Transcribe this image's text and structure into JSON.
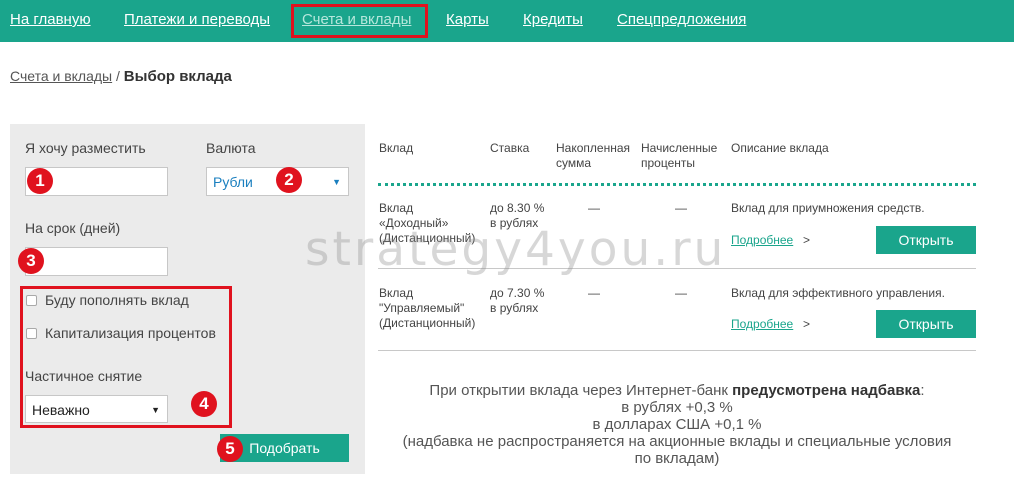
{
  "nav": {
    "items": [
      {
        "label": "На главную"
      },
      {
        "label": "Платежи и переводы"
      },
      {
        "label": "Счета и вклады"
      },
      {
        "label": "Карты"
      },
      {
        "label": "Кредиты"
      },
      {
        "label": "Спецпредложения"
      }
    ],
    "active_index": 2
  },
  "breadcrumb": {
    "parent": "Счета и вклады",
    "separator": "/",
    "current": "Выбор вклада"
  },
  "filters": {
    "amount_label": "Я хочу разместить",
    "amount_value": "",
    "currency_label": "Валюта",
    "currency_value": "Рубли",
    "term_label": "На срок (дней)",
    "term_value": "",
    "replenish_label": "Буду пополнять вклад",
    "replenish_checked": false,
    "capitalization_label": "Капитализация процентов",
    "capitalization_checked": false,
    "partial_label": "Частичное снятие",
    "partial_value": "Неважно",
    "submit_label": "Подобрать"
  },
  "table": {
    "headers": {
      "deposit": "Вклад",
      "rate": "Ставка",
      "accumulated": "Накопленная сумма",
      "accrued": "Начисленные проценты",
      "description": "Описание вклада"
    },
    "rows": [
      {
        "name_line1": "Вклад",
        "name_line2": "«Доходный»",
        "name_line3": "(Дистанционный)",
        "rate_line1": "до 8.30 %",
        "rate_line2": "в рублях",
        "accumulated": "—",
        "accrued": "—",
        "description": "Вклад для приумножения средств.",
        "more_label": "Подробнее",
        "more_arrow": ">",
        "open_label": "Открыть"
      },
      {
        "name_line1": "Вклад",
        "name_line2": "\"Управляемый\"",
        "name_line3": "(Дистанционный)",
        "rate_line1": "до 7.30 %",
        "rate_line2": "в рублях",
        "accumulated": "—",
        "accrued": "—",
        "description": "Вклад для эффективного управления.",
        "more_label": "Подробнее",
        "more_arrow": ">",
        "open_label": "Открыть"
      }
    ]
  },
  "notice": {
    "line1_prefix": "При открытии вклада через Интернет-банк",
    "line1_bold": "предусмотрена надбавка",
    "line1_suffix": ":",
    "line2": "в рублях +0,3 %",
    "line3": "в долларах США +0,1 %",
    "line4": "(надбавка не распространяется на акционные вклады и специальные условия",
    "line5": "по вкладам)"
  },
  "annotations": {
    "badge1": "1",
    "badge2": "2",
    "badge3": "3",
    "badge4": "4",
    "badge5": "5"
  },
  "watermark": "strategy4you.ru",
  "colors": {
    "brand": "#1aa58c",
    "highlight": "#e0121e",
    "panel_bg": "#ebebeb"
  }
}
